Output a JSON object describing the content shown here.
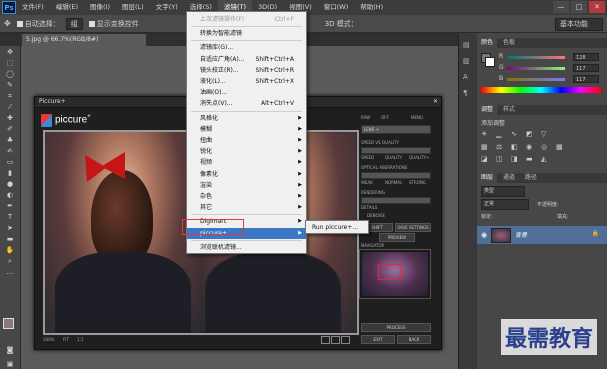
{
  "menubar": {
    "logo": "Ps",
    "items": [
      "文件(F)",
      "编辑(E)",
      "图像(I)",
      "图层(L)",
      "文字(Y)",
      "选择(S)",
      "滤镜(T)",
      "3D(D)",
      "视图(V)",
      "窗口(W)",
      "帮助(H)"
    ],
    "active_index": 6
  },
  "window_controls": [
    "—",
    "□",
    "✕"
  ],
  "optbar": {
    "auto_select_label": "自动选择：",
    "auto_select_value": "组",
    "show_transform_label": "显示变换控件",
    "mode_3d": "3D 模式：",
    "workspace": "基本功能"
  },
  "doc_tab": "5.jpg @ 66.7%(RGB/8#)",
  "filter_menu": {
    "rows": [
      {
        "label": "上次滤镜操作(F)",
        "shortcut": "Ctrl+F",
        "disabled": true
      },
      {
        "label": "转换为智能滤镜",
        "shortcut": ""
      },
      {
        "label": "滤镜库(G)...",
        "shortcut": ""
      },
      {
        "label": "自适应广角(A)...",
        "shortcut": "Shift+Ctrl+A"
      },
      {
        "label": "镜头校正(R)...",
        "shortcut": "Shift+Ctrl+R"
      },
      {
        "label": "液化(L)...",
        "shortcut": "Shift+Ctrl+X"
      },
      {
        "label": "油画(O)...",
        "shortcut": ""
      },
      {
        "label": "消失点(V)...",
        "shortcut": "Alt+Ctrl+V"
      },
      {
        "label": "风格化",
        "submenu": true
      },
      {
        "label": "模糊",
        "submenu": true
      },
      {
        "label": "扭曲",
        "submenu": true
      },
      {
        "label": "锐化",
        "submenu": true
      },
      {
        "label": "视频",
        "submenu": true
      },
      {
        "label": "像素化",
        "submenu": true
      },
      {
        "label": "渲染",
        "submenu": true
      },
      {
        "label": "杂色",
        "submenu": true
      },
      {
        "label": "其它",
        "submenu": true
      },
      {
        "label": "Digimarc",
        "submenu": true
      },
      {
        "label": "piccure+",
        "submenu": true,
        "highlighted": true
      },
      {
        "label": "浏览联机滤镜...",
        "shortcut": ""
      }
    ],
    "submenu_item": "Run piccure+..."
  },
  "piccure": {
    "title": "Piccure+",
    "close": "✕",
    "logo_text": "piccure",
    "logo_sup": "+",
    "labels": {
      "raw": "RAW",
      "off": "OFF",
      "mode": "MENU",
      "lens": "LENS +",
      "speed": "SPEED VS QUALITY",
      "speed_opts": [
        "SPEED",
        "QUALITY",
        "QUALITY+"
      ],
      "optical": "OPTICAL ABERRATIONS",
      "optical_opts": [
        "WEAK",
        "NORMAL",
        "STRONG"
      ],
      "rendering": "RENDERING",
      "details": "DETAILS",
      "denoise": "DENOISE",
      "preview": "PREVIEW",
      "shift": "SHIFT",
      "save_settings": "SAVE SETTINGS",
      "navigator": "NAVIGATOR",
      "process": "PROCESS",
      "exit": "EXIT",
      "back": "BACK",
      "zoom": "100%",
      "fit": "FIT",
      "one": "1:1"
    }
  },
  "panels": {
    "color_tabs": [
      "颜色",
      "色板"
    ],
    "rgb_labels": [
      "R",
      "G",
      "B"
    ],
    "rgb_values": [
      "128",
      "117",
      "117"
    ],
    "adjust_tabs": [
      "调整",
      "样式"
    ],
    "adjust_title": "添加调整",
    "layers_tabs": [
      "图层",
      "通道",
      "路径"
    ],
    "kind_label": "类型",
    "blend_mode": "正常",
    "opacity_label": "不透明度:",
    "lock_label": "锁定:",
    "fill_label": "填充:",
    "layer_name": "背景"
  },
  "colors": {
    "accent": "#3b77c4",
    "highlight_box": "#e23b3b",
    "watermark": "#2b3f8f"
  },
  "watermark": "最需教育"
}
